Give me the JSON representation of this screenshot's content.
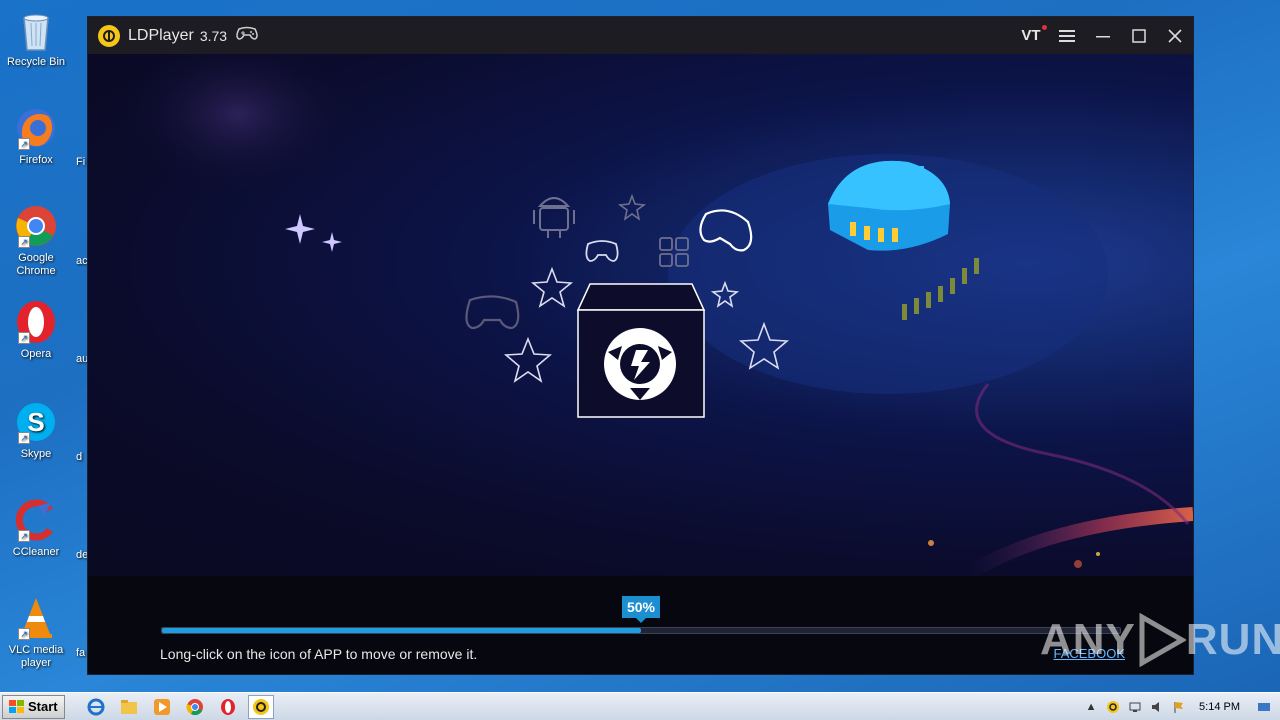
{
  "desktop": {
    "icons": [
      {
        "label": "Recycle Bin",
        "icon": "recycle-bin-icon"
      },
      {
        "label": "Firefox",
        "icon": "firefox-icon"
      },
      {
        "label": "Google Chrome",
        "icon": "chrome-icon"
      },
      {
        "label": "Opera",
        "icon": "opera-icon"
      },
      {
        "label": "Skype",
        "icon": "skype-icon"
      },
      {
        "label": "CCleaner",
        "icon": "ccleaner-icon"
      },
      {
        "label": "VLC media player",
        "icon": "vlc-icon"
      }
    ],
    "side_labels": [
      "Fi",
      "ac",
      "au",
      "d",
      "de",
      "fa"
    ]
  },
  "window": {
    "app_name": "LDPlayer",
    "version": "3.73",
    "vt_label": "VT",
    "controls": [
      "menu-icon",
      "minimize-icon",
      "maximize-icon",
      "close-icon"
    ]
  },
  "loading": {
    "progress_label": "50%",
    "progress_fraction": 0.5,
    "tip": "Long-click on the icon of APP to move or remove it.",
    "link": "FACEBOOK"
  },
  "watermark": {
    "text_left": "ANY",
    "text_right": "RUN"
  },
  "taskbar": {
    "start_label": "Start",
    "apps": [
      "ie-icon",
      "explorer-icon",
      "media-player-icon",
      "chrome-icon",
      "opera-icon",
      "ldplayer-icon"
    ],
    "clock": "5:14 PM"
  },
  "colors": {
    "accent": "#1e9ddf",
    "title_bar": "#1c1c22",
    "link": "#6ab6ff",
    "logo": "#f5c518"
  }
}
